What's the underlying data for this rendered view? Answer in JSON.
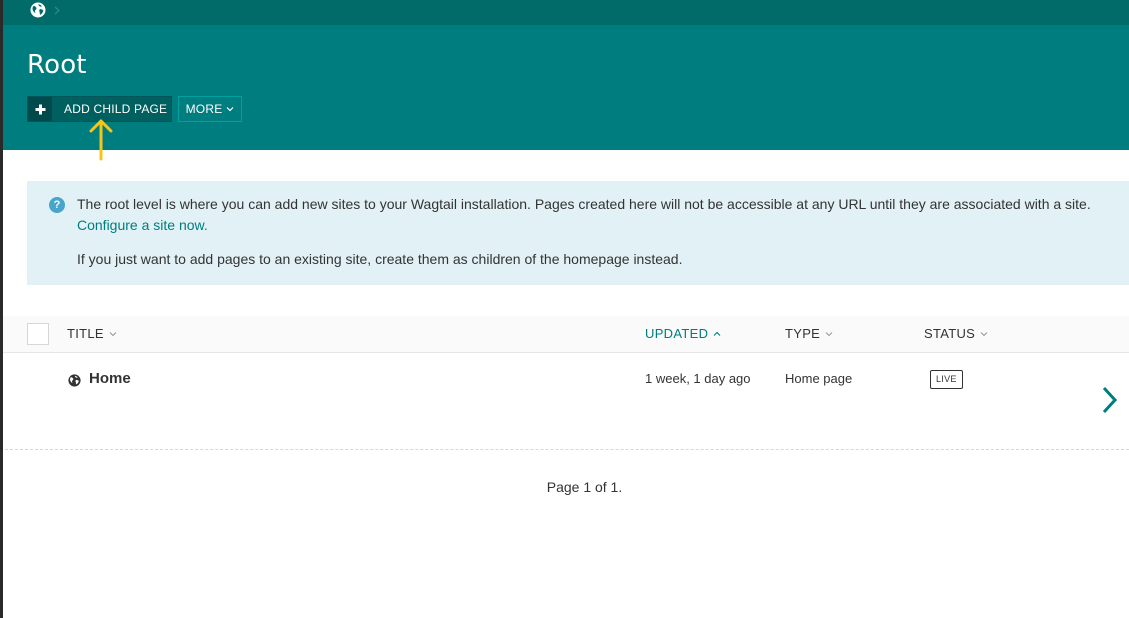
{
  "breadcrumb": {
    "root_icon": "globe-icon",
    "separator_icon": "chevron-right-icon"
  },
  "header": {
    "title": "Root",
    "add_child_label": "ADD CHILD PAGE",
    "add_child_icon": "plus-icon",
    "more_label": "MORE",
    "more_icon": "chevron-down-icon"
  },
  "annotation": {
    "arrow_icon": "arrow-up-icon",
    "color": "#f5c518"
  },
  "help": {
    "icon": "help-icon",
    "text_before_link": "The root level is where you can add new sites to your Wagtail installation. Pages created here will not be accessible at any URL until they are associated with a site.",
    "link_text": "Configure a site now.",
    "second_paragraph": "If you just want to add pages to an existing site, create them as children of the homepage instead."
  },
  "table": {
    "columns": [
      {
        "label": "TITLE",
        "sort_icon": "chevron-down-icon"
      },
      {
        "label": "UPDATED",
        "sort_icon": "chevron-up-icon",
        "active": true
      },
      {
        "label": "TYPE",
        "sort_icon": "chevron-down-icon"
      },
      {
        "label": "STATUS",
        "sort_icon": "chevron-down-icon"
      }
    ],
    "rows": [
      {
        "icon": "globe-icon",
        "title": "Home",
        "updated": "1 week, 1 day ago",
        "type": "Home page",
        "status": "LIVE",
        "explore_icon": "chevron-right-icon"
      }
    ]
  },
  "pagination": {
    "text": "Page 1 of 1."
  },
  "colors": {
    "breadcrumb_bg": "#006b68",
    "header_bg": "#007d7e",
    "accent": "#007d7e",
    "help_bg": "#e2f1f6",
    "help_icon": "#48a6cc"
  }
}
